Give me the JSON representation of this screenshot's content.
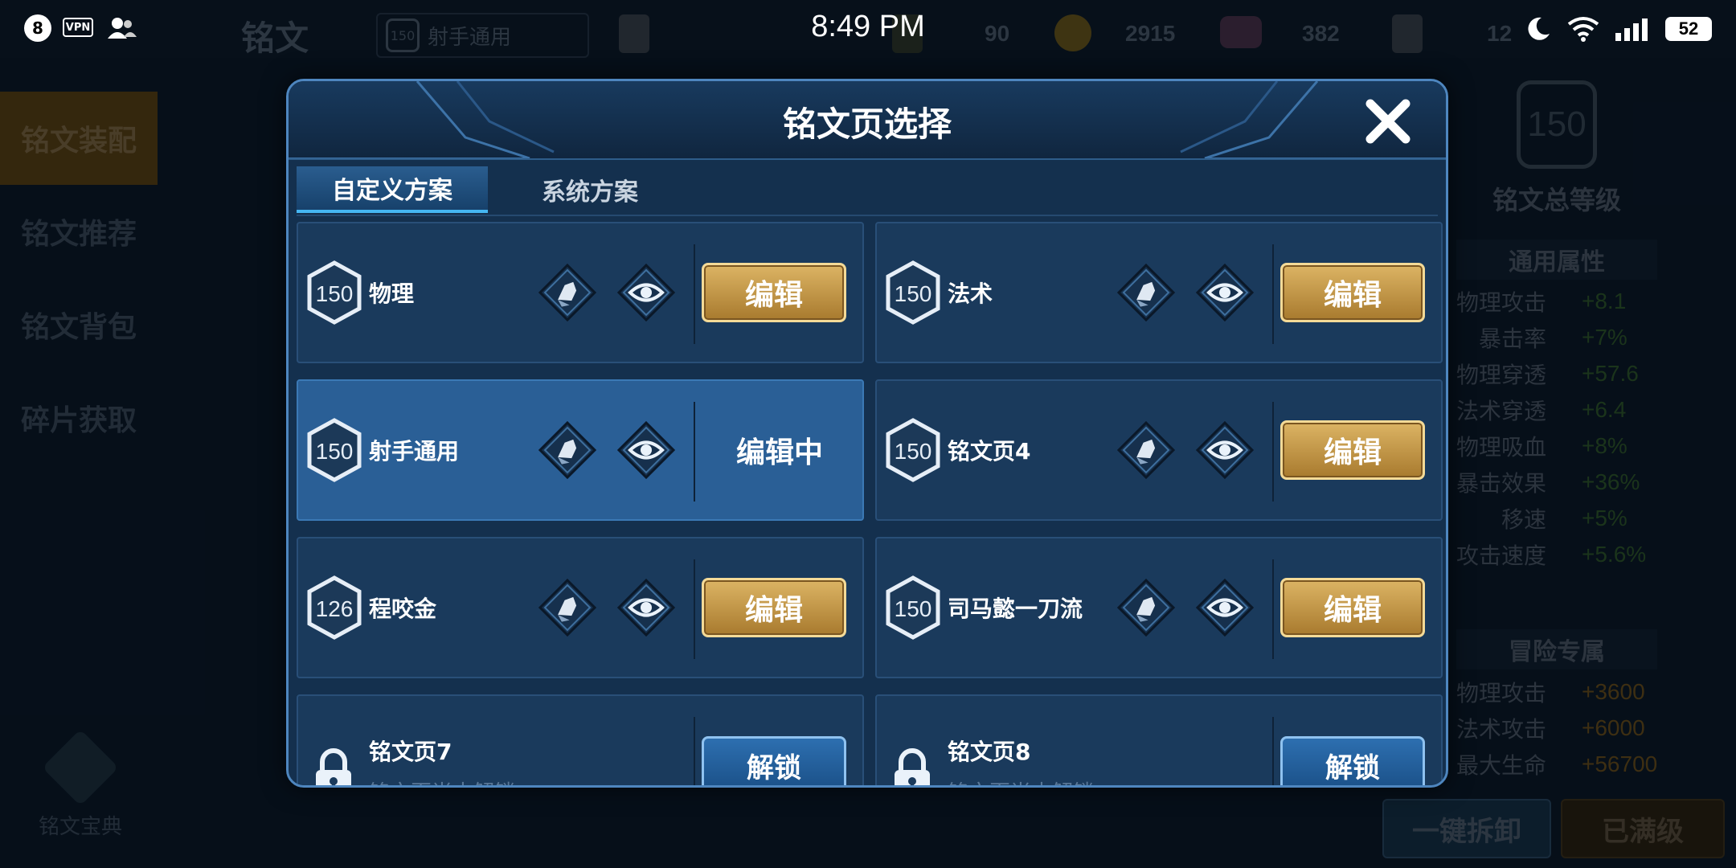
{
  "status_bar": {
    "notification_count": "8",
    "vpn_label": "VPN",
    "time": "8:49 PM",
    "battery": "52"
  },
  "background": {
    "title": "铭文",
    "current_loadout": {
      "level": "150",
      "name": "射手通用"
    },
    "resources": {
      "item1": "90",
      "gold": "2915",
      "gems": "382",
      "cards": "12"
    },
    "sidenav": [
      "铭文装配",
      "铭文推荐",
      "铭文背包",
      "碎片获取"
    ],
    "codex_label": "铭文宝典",
    "total_level": "150",
    "total_level_label": "铭文总等级",
    "general_attrs_title": "通用属性",
    "general_attrs": [
      {
        "name": "物理攻击",
        "value": "+8.1"
      },
      {
        "name": "暴击率",
        "value": "+7%"
      },
      {
        "name": "物理穿透",
        "value": "+57.6"
      },
      {
        "name": "法术穿透",
        "value": "+6.4"
      },
      {
        "name": "物理吸血",
        "value": "+8%"
      },
      {
        "name": "暴击效果",
        "value": "+36%"
      },
      {
        "name": "移速",
        "value": "+5%"
      },
      {
        "name": "攻击速度",
        "value": "+5.6%"
      }
    ],
    "adventure_title": "冒险专属",
    "adventure_attrs": [
      {
        "name": "物理攻击",
        "value": "+3600"
      },
      {
        "name": "法术攻击",
        "value": "+6000"
      },
      {
        "name": "最大生命",
        "value": "+56700"
      }
    ],
    "dismantle_label": "一键拆卸",
    "maxed_label": "已满级"
  },
  "modal": {
    "title": "铭文页选择",
    "tabs": [
      "自定义方案",
      "系统方案"
    ],
    "edit_label": "编辑",
    "editing_label": "编辑中",
    "unlock_label": "解锁",
    "pages": [
      {
        "level": "150",
        "name": "物理",
        "state": "edit"
      },
      {
        "level": "150",
        "name": "法术",
        "state": "edit"
      },
      {
        "level": "150",
        "name": "射手通用",
        "state": "editing"
      },
      {
        "level": "150",
        "name": "铭文页4",
        "state": "edit"
      },
      {
        "level": "126",
        "name": "程咬金",
        "state": "edit"
      },
      {
        "level": "150",
        "name": "司马懿一刀流",
        "state": "edit"
      }
    ],
    "locked_pages": [
      {
        "name": "铭文页7",
        "sub": "铭文页尚未解锁"
      },
      {
        "name": "铭文页8",
        "sub": "铭文页尚未解锁"
      }
    ]
  },
  "colors": {
    "gold_button": "#c99b4c",
    "editing_card": "#2a5f96",
    "active_tab_underline": "#45b6f2"
  }
}
